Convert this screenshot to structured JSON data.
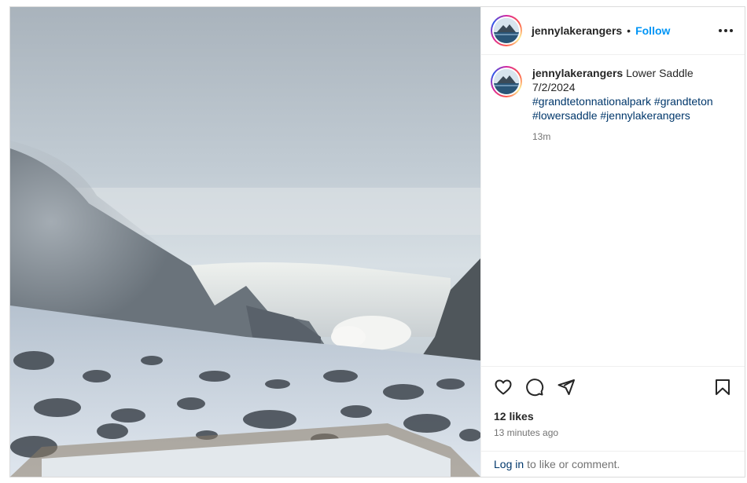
{
  "post": {
    "image_alt": "Snowy rocky slope in fog at Lower Saddle"
  },
  "header": {
    "username": "jennylakerangers",
    "separator": "•",
    "follow_label": "Follow"
  },
  "caption": {
    "username": "jennylakerangers",
    "title": "Lower Saddle",
    "date": "7/2/2024",
    "hashtags": [
      "#grandtetonnationalpark",
      "#grandteton",
      "#lowersaddle",
      "#jennylakerangers"
    ],
    "time_ago": "13m"
  },
  "actions": {
    "icons": [
      "heart-icon",
      "comment-icon",
      "share-icon",
      "bookmark-icon"
    ]
  },
  "likes": "12 likes",
  "timestamp": "13 minutes ago",
  "login": {
    "link_text": "Log in",
    "rest_text": "to like or comment."
  }
}
